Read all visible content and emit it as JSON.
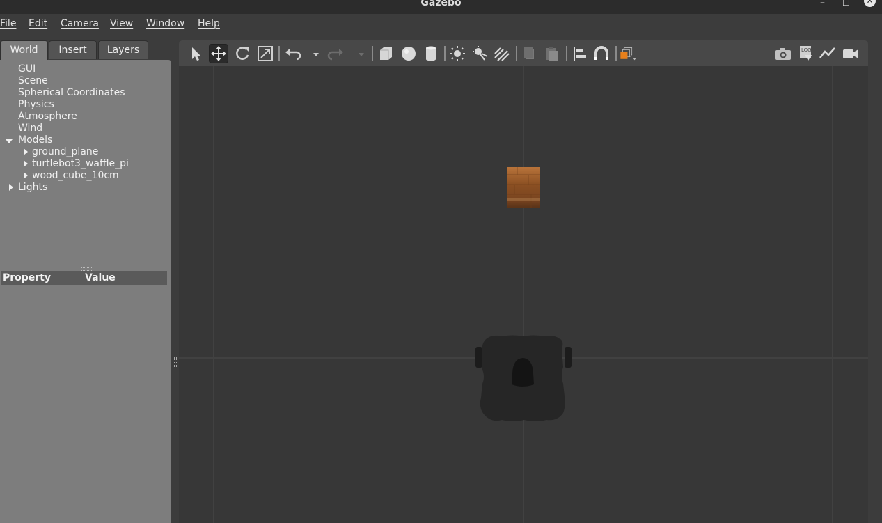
{
  "window": {
    "title": "Gazebo",
    "minimize": "–",
    "maximize": "☐",
    "close": "✕"
  },
  "menubar": [
    {
      "id": "file",
      "label": "File"
    },
    {
      "id": "edit",
      "label": "Edit"
    },
    {
      "id": "camera",
      "label": "Camera"
    },
    {
      "id": "view",
      "label": "View"
    },
    {
      "id": "window",
      "label": "Window"
    },
    {
      "id": "help",
      "label": "Help"
    }
  ],
  "tabs": [
    {
      "label": "World",
      "active": true
    },
    {
      "label": "Insert",
      "active": false
    },
    {
      "label": "Layers",
      "active": false
    }
  ],
  "world_tree": {
    "items": [
      "GUI",
      "Scene",
      "Spherical Coordinates",
      "Physics",
      "Atmosphere",
      "Wind"
    ],
    "models_label": "Models",
    "models": [
      "ground_plane",
      "turtlebot3_waffle_pi",
      "wood_cube_10cm"
    ],
    "lights_label": "Lights"
  },
  "property_table": {
    "col_property": "Property",
    "col_value": "Value"
  },
  "toolbar": {
    "active_tool": "translate-mode",
    "icons": [
      "select-mode-icon",
      "translate-mode-icon",
      "rotate-mode-icon",
      "scale-mode-icon",
      "undo-icon",
      "redo-icon",
      "box-shape-icon",
      "sphere-shape-icon",
      "cylinder-shape-icon",
      "point-light-icon",
      "spot-light-icon",
      "directional-light-icon",
      "copy-icon",
      "paste-icon",
      "align-icon",
      "snap-icon",
      "view-angle-icon",
      "screenshot-icon",
      "log-icon",
      "plot-icon",
      "video-record-icon"
    ]
  },
  "colors": {
    "accent_orange": "#e8801c",
    "viewport_bg": "#373737",
    "panel_bg": "#7d7d7d"
  }
}
